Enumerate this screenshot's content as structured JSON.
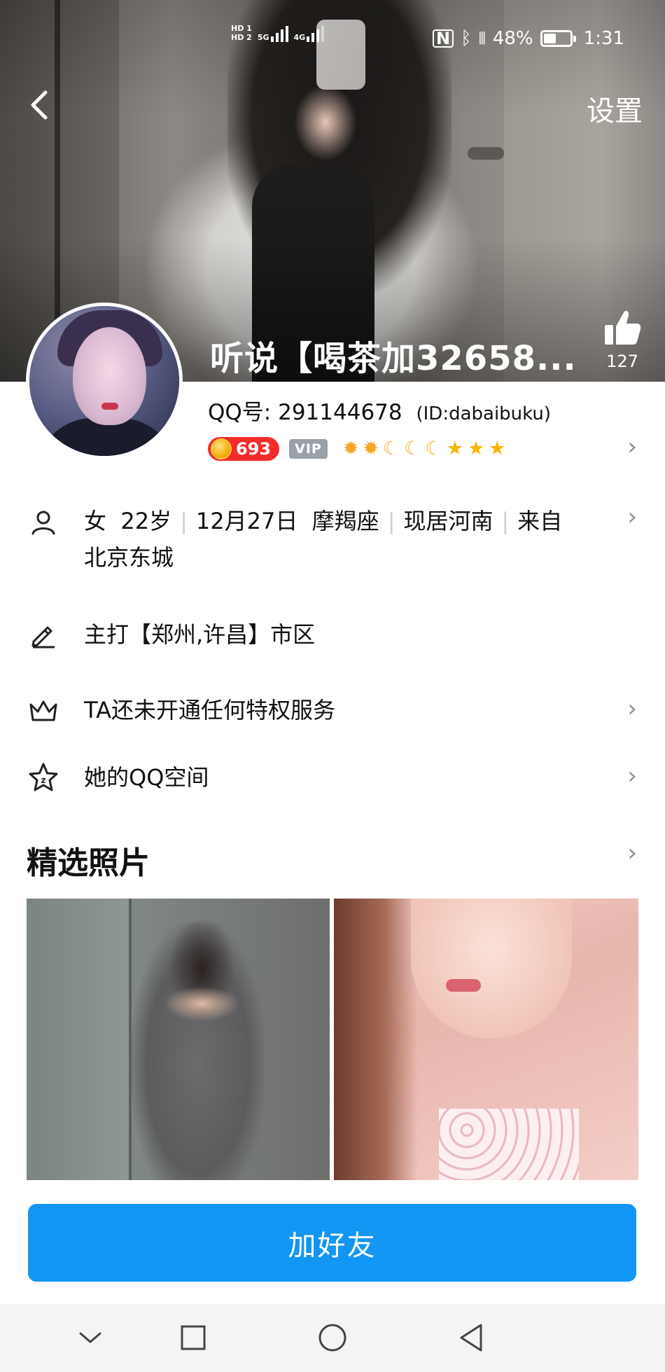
{
  "status_bar": {
    "hd1": "HD 1",
    "hd2": "HD 2",
    "net1": "5G",
    "net2": "4G",
    "battery_text": "48%",
    "battery_level": 0.48,
    "time": "1:31"
  },
  "header": {
    "back_icon": "chevron-left-icon",
    "settings_label": "设置",
    "nickname": "听说【喝茶加32658...",
    "like_count": "127"
  },
  "profile": {
    "qq_label": "QQ号:",
    "qq_number": "291144678",
    "id_text": "(ID:dabaibuku)",
    "level_number": "693",
    "vip_label": "VIP",
    "level_icons": [
      "sun",
      "sun",
      "moon",
      "moon",
      "moon",
      "star",
      "star",
      "star"
    ]
  },
  "details": {
    "gender": "女",
    "age": "22岁",
    "birthday": "12月27日",
    "zodiac": "摩羯座",
    "location": "现居河南",
    "hometown_prefix": "来自",
    "hometown": "北京东城",
    "signature": "主打【郑州,许昌】市区",
    "privilege": "TA还未开通任何特权服务",
    "qzone": "她的QQ空间"
  },
  "photos": {
    "title": "精选照片"
  },
  "actions": {
    "add_friend": "加好友"
  },
  "colors": {
    "primary": "#1296f3",
    "level_badge": "#f22b2b",
    "vip_badge": "#9aa0a8"
  }
}
